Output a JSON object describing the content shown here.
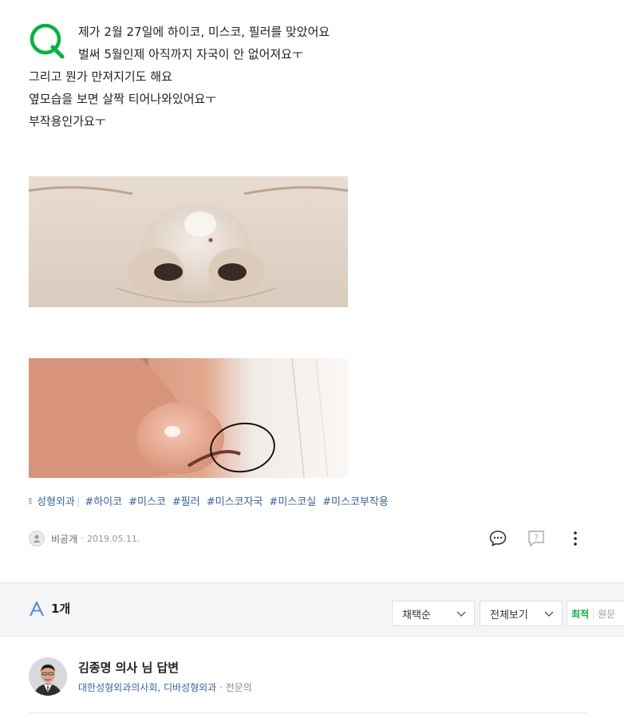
{
  "question": {
    "lines": [
      "제가 2월 27일에 하이코, 미스코, 필러를 맞았어요",
      "벌써 5월인제 아직까지 자국이 안 없어져요ㅜ",
      "그리고 뭔가 만져지기도 해요",
      "옆모습을 보면 살짝 티어나와있어요ㅜ",
      "부작용인가요ㅜ"
    ],
    "accent_color": "#00b43c"
  },
  "tags": {
    "category": "ㅌ 성형외과",
    "items": [
      "#하이코",
      "#미스코",
      "#필러",
      "#미스코자국",
      "#미스코실",
      "#미스코부작용"
    ]
  },
  "meta": {
    "author": "비공개",
    "date": "2019.05.11."
  },
  "actions": [
    "comment-icon",
    "question-report-icon",
    "more-icon"
  ],
  "answers": {
    "count_label": "1개",
    "filter1": "채택순",
    "filter2": "전체보기",
    "sort_active": "최적",
    "sort_other": "원문"
  },
  "answer": {
    "doctor_name": "김종명 의사 님 답변",
    "org": "대한성형외과의사회, 디바성형외과",
    "role": "전문의"
  }
}
